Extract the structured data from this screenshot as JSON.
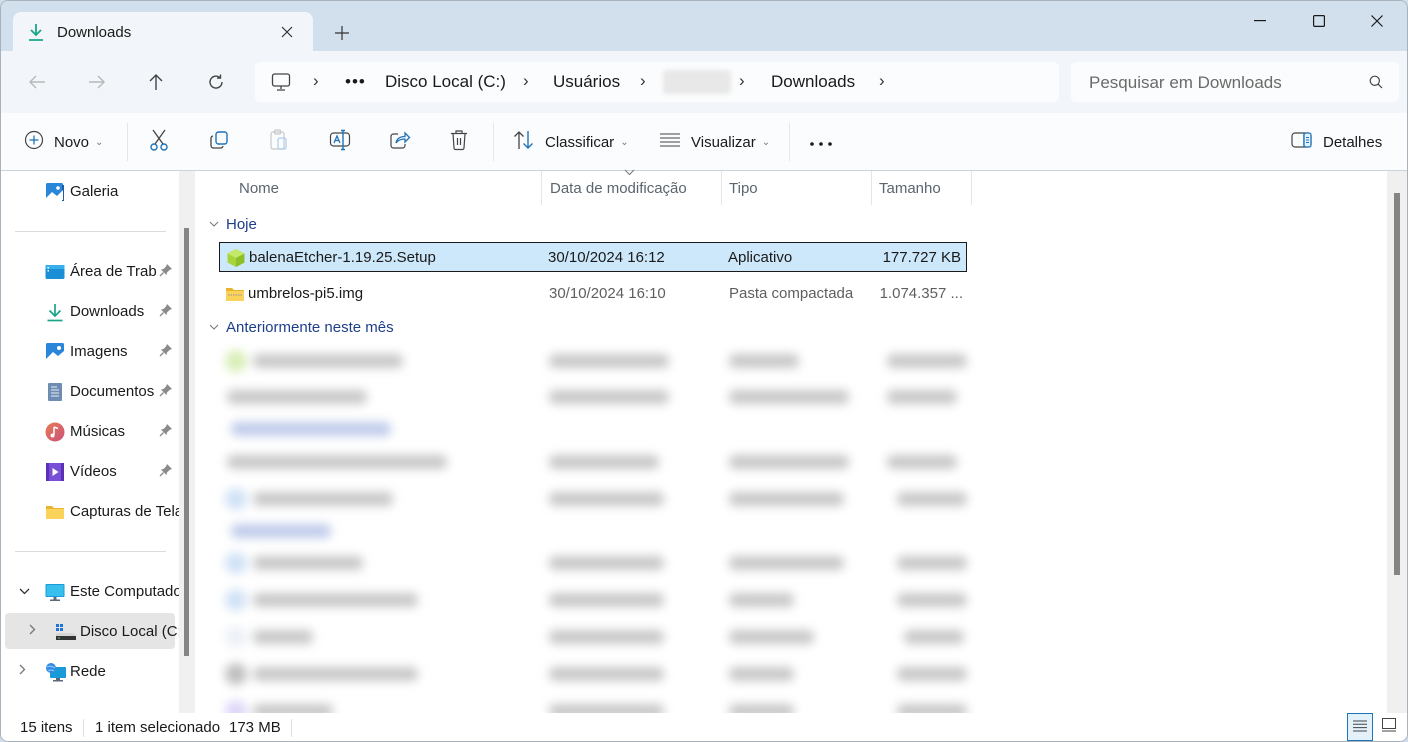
{
  "window": {
    "tab_title": "Downloads",
    "tab_icon": "download-icon",
    "controls": [
      "minimize",
      "maximize",
      "close"
    ]
  },
  "nav": {
    "breadcrumb": [
      {
        "label": "Disco Local (C:)"
      },
      {
        "label": "Usuários"
      },
      {
        "label": "",
        "redacted": true
      },
      {
        "label": "Downloads"
      }
    ],
    "overflow_label": "•••",
    "search_placeholder": "Pesquisar em Downloads"
  },
  "commands": {
    "new_label": "Novo",
    "sort_label": "Classificar",
    "view_label": "Visualizar",
    "more_label": "•••",
    "details_label": "Detalhes"
  },
  "sidebar": {
    "items": [
      {
        "label": "Galeria",
        "icon": "gallery-icon"
      },
      {
        "label": "Área de Trab",
        "icon": "desktop-icon",
        "pinned": true
      },
      {
        "label": "Downloads",
        "icon": "download-icon",
        "pinned": true
      },
      {
        "label": "Imagens",
        "icon": "pictures-icon",
        "pinned": true
      },
      {
        "label": "Documentos",
        "icon": "documents-icon",
        "pinned": true
      },
      {
        "label": "Músicas",
        "icon": "music-icon",
        "pinned": true
      },
      {
        "label": "Vídeos",
        "icon": "videos-icon",
        "pinned": true
      },
      {
        "label": "Capturas de Tela",
        "icon": "folder-icon"
      },
      {
        "label": "Este Computador",
        "icon": "computer-icon",
        "expanded": true
      },
      {
        "label": "Disco Local (C:)",
        "icon": "drive-icon",
        "selected": true
      },
      {
        "label": "Rede",
        "icon": "network-icon"
      }
    ]
  },
  "filelist": {
    "columns": [
      "Nome",
      "Data de modificação",
      "Tipo",
      "Tamanho"
    ],
    "sorted_by": "Data de modificação",
    "groups": [
      {
        "label": "Hoje",
        "files": [
          {
            "name": "balenaEtcher-1.19.25.Setup",
            "modified": "30/10/2024 16:12",
            "type": "Aplicativo",
            "size": "177.727 KB",
            "icon": "app-package-icon",
            "selected": true
          },
          {
            "name": "umbrelos-pi5.img",
            "modified": "30/10/2024 16:10",
            "type": "Pasta compactada",
            "size": "1.074.357 ...",
            "icon": "zip-folder-icon"
          }
        ]
      },
      {
        "label": "Anteriormente neste mês",
        "files_redacted": true
      }
    ]
  },
  "status": {
    "item_count": "15 itens",
    "selection": "1 item selecionado",
    "selection_size": "173 MB",
    "view_mode": "details"
  },
  "colors": {
    "accent": "#1f73b7",
    "selection_bg": "#cce8fa",
    "group_text": "#1e3e8a",
    "titlebar_bg": "#d1e0ec",
    "download_green": "#1aa58a"
  }
}
